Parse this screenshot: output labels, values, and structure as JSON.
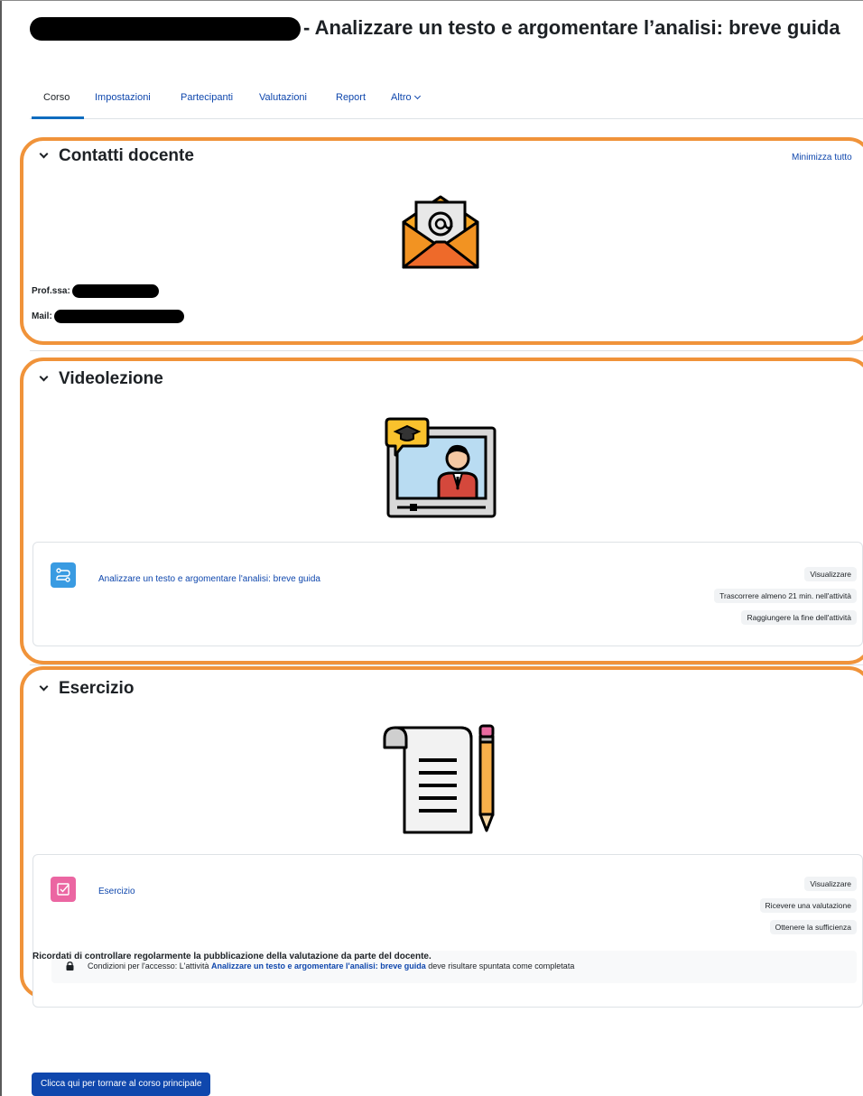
{
  "page": {
    "title": "- Analizzare un testo e argomentare l’analisi: breve guida"
  },
  "nav": {
    "items": [
      {
        "label": "Corso"
      },
      {
        "label": "Impostazioni"
      },
      {
        "label": "Partecipanti"
      },
      {
        "label": "Valutazioni"
      },
      {
        "label": "Report"
      },
      {
        "label": "Altro"
      }
    ]
  },
  "sections": {
    "contatti": {
      "title": "Contatti docente",
      "collapse_all": "Minimizza tutto",
      "prof_label": "Prof.ssa:",
      "mail_label": "Mail:"
    },
    "videolezione": {
      "title": "Videolezione",
      "activity": {
        "name": "Analizzare un testo e argomentare l'analisi: breve guida",
        "conditions": [
          "Visualizzare",
          "Trascorrere almeno 21 min. nell'attività",
          "Raggiungere la fine dell'attività"
        ]
      }
    },
    "esercizio": {
      "title": "Esercizio",
      "activity": {
        "name": "Esercizio",
        "conditions": [
          "Visualizzare",
          "Ricevere una valutazione",
          "Ottenere la sufficienza"
        ],
        "restriction_prefix": "Condizioni per l'accesso: L'attività ",
        "restriction_activity": "Analizzare un testo e argomentare l'analisi: breve guida",
        "restriction_suffix": " deve risultare spuntata come completata"
      }
    }
  },
  "footer": {
    "reminder": "Ricordati di controllare regolarmente la pubblicazione della valutazione da parte del docente.",
    "back_button": "Clicca qui per tornare al corso principale"
  },
  "colors": {
    "accent": "#0f47ad",
    "highlight_border": "#f0933a",
    "video_icon_bg": "#399be2",
    "assign_icon_bg": "#eb66a2"
  },
  "icons": [
    "email-envelope-icon",
    "video-lesson-icon",
    "notepad-pencil-icon",
    "video-activity-icon",
    "assignment-icon",
    "lock-icon",
    "chevron-down-icon"
  ]
}
